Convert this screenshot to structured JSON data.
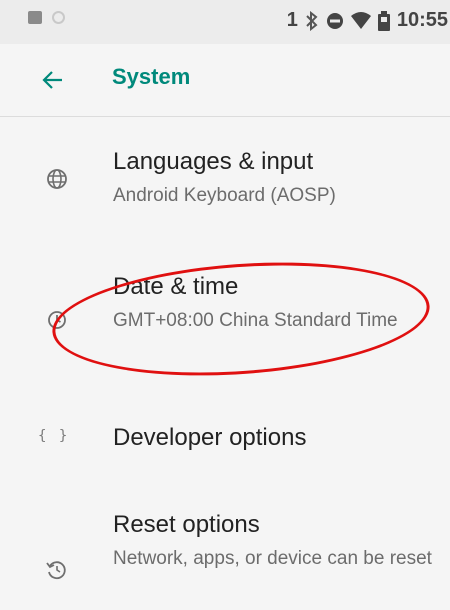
{
  "status_bar": {
    "notification_icons": [
      "image-icon",
      "circle-icon"
    ],
    "indicator_text": "1",
    "icons": [
      "bluetooth-icon",
      "do-not-disturb-icon",
      "wifi-icon",
      "battery-icon"
    ],
    "time": "10:55"
  },
  "app_bar": {
    "back_icon": "arrow-left-icon",
    "title": "System",
    "accent_color": "#00897b"
  },
  "items": [
    {
      "icon": "globe-icon",
      "title": "Languages & input",
      "summary": "Android Keyboard (AOSP)"
    },
    {
      "icon": "clock-icon",
      "title": "Date & time",
      "summary": "GMT+08:00 China Standard Time"
    },
    {
      "icon": "braces-icon",
      "icon_text": "{ }",
      "title": "Developer options",
      "summary": ""
    },
    {
      "icon": "restore-icon",
      "title": "Reset options",
      "summary": "Network, apps, or device can be reset"
    }
  ],
  "annotation": {
    "shape": "ellipse",
    "color": "#e01010",
    "target": "Date & time"
  }
}
